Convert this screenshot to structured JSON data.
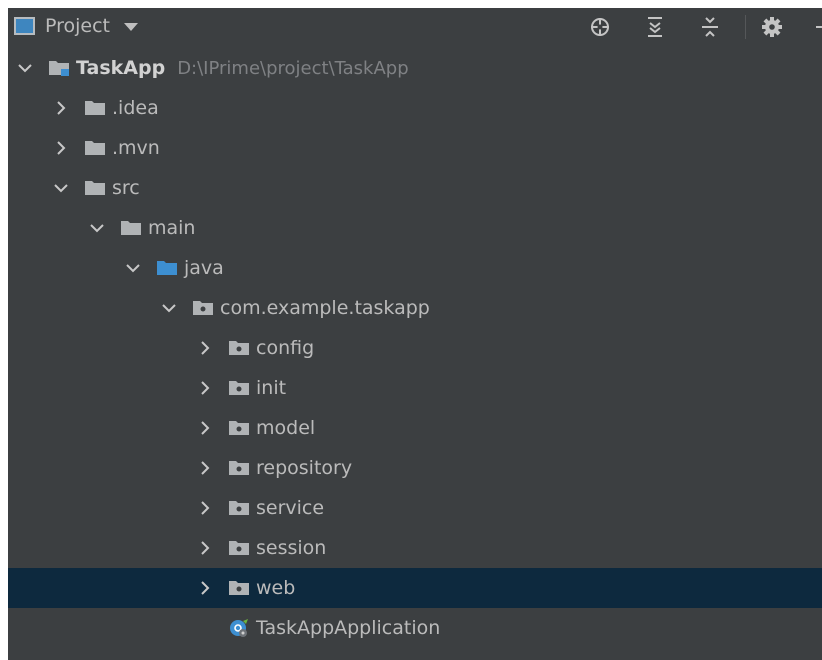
{
  "toolbar": {
    "view_name": "Project",
    "icons": [
      "locate-icon",
      "expand-all-icon",
      "collapse-all-icon",
      "gear-icon"
    ]
  },
  "colors": {
    "panel_bg": "#3c3f41",
    "selection_bg": "#0d293e",
    "text": "#bbbbbb",
    "path_text": "#7f8184",
    "folder_gray": "#b0b3b5",
    "source_folder_blue": "#3d8fd1"
  },
  "tree": [
    {
      "id": "taskapp",
      "label": "TaskApp",
      "path": "D:\\IPrime\\project\\TaskApp",
      "level": 0,
      "state": "expanded",
      "icon": "module-folder-icon"
    },
    {
      "id": "idea",
      "label": ".idea",
      "level": 1,
      "state": "collapsed",
      "icon": "folder-icon"
    },
    {
      "id": "mvn",
      "label": ".mvn",
      "level": 1,
      "state": "collapsed",
      "icon": "folder-icon"
    },
    {
      "id": "src",
      "label": "src",
      "level": 1,
      "state": "expanded",
      "icon": "folder-icon"
    },
    {
      "id": "main",
      "label": "main",
      "level": 2,
      "state": "expanded",
      "icon": "folder-icon"
    },
    {
      "id": "java",
      "label": "java",
      "level": 3,
      "state": "expanded",
      "icon": "source-folder-icon"
    },
    {
      "id": "com-example-taskapp",
      "label": "com.example.taskapp",
      "level": 4,
      "state": "expanded",
      "icon": "package-icon"
    },
    {
      "id": "config",
      "label": "config",
      "level": 5,
      "state": "collapsed",
      "icon": "package-icon"
    },
    {
      "id": "init",
      "label": "init",
      "level": 5,
      "state": "collapsed",
      "icon": "package-icon"
    },
    {
      "id": "model",
      "label": "model",
      "level": 5,
      "state": "collapsed",
      "icon": "package-icon"
    },
    {
      "id": "repository",
      "label": "repository",
      "level": 5,
      "state": "collapsed",
      "icon": "package-icon"
    },
    {
      "id": "service",
      "label": "service",
      "level": 5,
      "state": "collapsed",
      "icon": "package-icon"
    },
    {
      "id": "session",
      "label": "session",
      "level": 5,
      "state": "collapsed",
      "icon": "package-icon"
    },
    {
      "id": "web",
      "label": "web",
      "level": 5,
      "state": "collapsed",
      "selected": true,
      "icon": "package-icon"
    },
    {
      "id": "taskappapplication",
      "label": "TaskAppApplication",
      "level": 5,
      "state": "leaf",
      "icon": "spring-boot-class-icon"
    }
  ]
}
